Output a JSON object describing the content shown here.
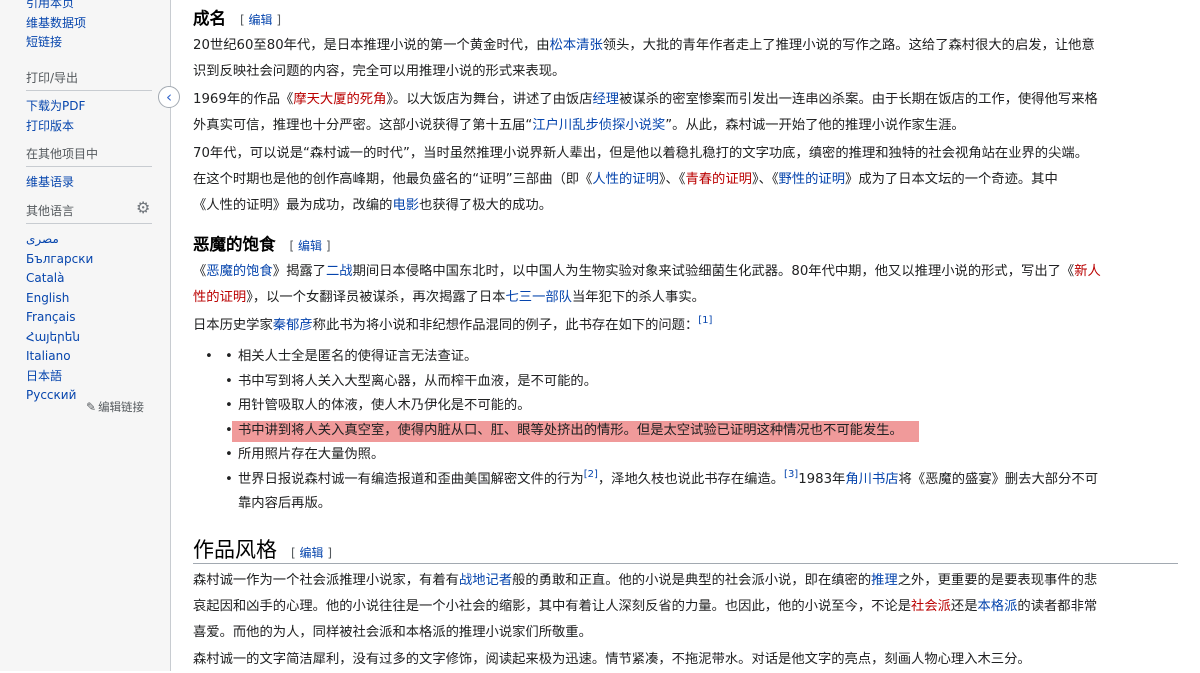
{
  "sidebar": {
    "top_items": [
      "引用本页",
      "维基数据项",
      "短链接"
    ],
    "print_heading": "打印/导出",
    "print_items": [
      "下载为PDF",
      "打印版本"
    ],
    "projects_heading": "在其他项目中",
    "projects_items": [
      "维基语录"
    ],
    "languages_heading": "其他语言",
    "languages": [
      "مصرى",
      "Български",
      "Català",
      "English",
      "Français",
      "Հայերեն",
      "Italiano",
      "日本語",
      "Русский"
    ],
    "edit_links": "编辑链接",
    "collapse_glyph": "‹"
  },
  "sections": {
    "fame": {
      "title": "成名",
      "edit": "编辑",
      "p1": {
        "l1a": "20世纪60至80年代，是日本推理小说的第一个黄金时代，由",
        "l1link": "松本清张",
        "l1b": "领头，大批的青年作者走上了推理小说的写作之路。这给了森村很大的启发，让他意",
        "l2": "识到反映社会问题的内容，完全可以用推理小说的形式来表现。"
      },
      "p2": {
        "l1a": "1969年的作品《",
        "l1link": "摩天大厦的死角",
        "l1b": "》。以大饭店为舞台，讲述了由饭店",
        "l1link2": "经理",
        "l1c": "被谋杀的密室惨案而引发出一连串凶杀案。由于长期在饭店的工作，使得他写来格",
        "l2a": "外真实可信，推理也十分严密。这部小说获得了第十五届“",
        "l2link": "江户川乱步侦探小说奖",
        "l2b": "”。从此，森村诚一开始了他的推理小说作家生涯。"
      },
      "p3": {
        "l1": "70年代，可以说是“森村诚一的时代”，当时虽然推理小说界新人辈出，但是他以着稳扎稳打的文字功底，缜密的推理和独特的社会视角站在业界的尖端。",
        "l2a": "在这个时期也是他的创作高峰期，他最负盛名的“证明”三部曲（即《",
        "l2link1": "人性的证明",
        "l2b": "》、《",
        "l2link2": "青春的证明",
        "l2c": "》、《",
        "l2link3": "野性的证明",
        "l2d": "》成为了日本文坛的一个奇迹。其中",
        "l3a": "《人性的证明》最为成功，改编的",
        "l3link": "电影",
        "l3b": "也获得了极大的成功。"
      }
    },
    "devil": {
      "title": "恶魔的饱食",
      "edit": "编辑",
      "p1": {
        "l1a": "《",
        "l1link": "恶魔的饱食",
        "l1b": "》揭露了",
        "l1link2": "二战",
        "l1c": "期间日本侵略中国东北时，以中国人为生物实验对象来试验细菌生化武器。80年代中期，他又以推理小说的形式，写出了《",
        "l1link3": "新人",
        "l2link": "性的证明",
        "l2a": "》，以一个女翻译员被谋杀，再次揭露了日本",
        "l2link2": "七三一部队",
        "l2b": "当年犯下的杀人事实。"
      },
      "p2": {
        "a": "日本历史学家",
        "link": "秦郁彦",
        "b": "称此书为将小说和非纪想作品混同的例子，此书存在如下的问题：",
        "ref": "[1]"
      },
      "bullets": [
        "相关人士全是匿名的使得证言无法查证。",
        "书中写到将人关入大型离心器，从而榨干血液，是不可能的。",
        "用针管吸取人的体液，使人木乃伊化是不可能的。",
        "书中讲到将人关入真空室，使得内脏从口、肛、眼等处挤出的情形。但是太空试验已证明这种情况也不可能发生。",
        "所用照片存在大量伪照。"
      ],
      "last_bullet": {
        "a": "世界日报说森村诚一有编造报道和歪曲美国解密文件的行为",
        "ref1": "[2]",
        "b": "，泽地久枝也说此书存在编造。",
        "ref2": "[3]",
        "c": "1983年",
        "link": "角川书店",
        "d": "将《恶魔的盛宴》删去大部分不可",
        "e": "靠内容后再版。"
      },
      "bullet_glyph": "•"
    },
    "style": {
      "title": "作品风格",
      "edit": "编辑",
      "p1": {
        "l1a": "森村诚一作为一个社会派推理小说家，有着有",
        "l1link": "战地记者",
        "l1b": "般的勇敢和正直。他的小说是典型的社会派小说，即在缜密的",
        "l1link2": "推理",
        "l1c": "之外，更重要的是要表现事件的悲",
        "l2a": "哀起因和凶手的心理。他的小说往往是一个小社会的缩影，其中有着让人深刻反省的力量。也因此，他的小说至今，不论是",
        "l2link": "社会派",
        "l2b": "还是",
        "l2link2": "本格派",
        "l2c": "的读者都非常",
        "l3": "喜爱。而他的为人，同样被社会派和本格派的推理小说家们所敬重。"
      },
      "p2": "森村诚一的文字简洁犀利，没有过多的文字修饰，阅读起来极为迅速。情节紧凑，不拖泥带水。对话是他文字的亮点，刻画人物心理入木三分。"
    }
  },
  "colors": {
    "link": "#0645ad",
    "redlink": "#ba0000",
    "highlight": "#f09a9a",
    "sidebar_bg": "#f6f6f6"
  },
  "icons": {
    "gear": "gear-icon",
    "pencil": "pencil-icon",
    "collapse": "chevron-left-icon"
  }
}
